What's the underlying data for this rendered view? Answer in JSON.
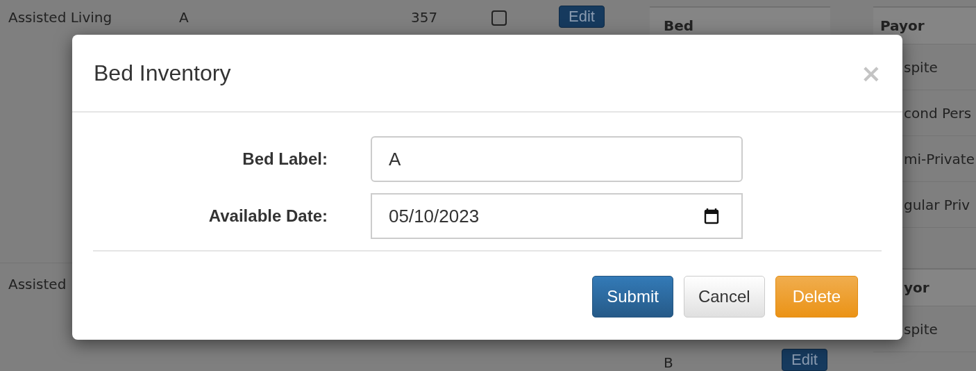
{
  "background": {
    "rows": [
      {
        "type": "Assisted Living",
        "bed": "A",
        "number": "357",
        "checked": false,
        "button": "Edit"
      },
      {
        "type": "Assisted"
      }
    ],
    "bed_panel": {
      "header": "Bed",
      "rows": [
        {
          "bed": "B",
          "button": "Edit"
        }
      ]
    },
    "payor_panels": [
      {
        "header": "Payor",
        "rows": [
          "spite",
          "cond Pers",
          "mi-Private",
          "gular Priv"
        ]
      },
      {
        "header": "yor",
        "rows": [
          "spite"
        ]
      }
    ]
  },
  "modal": {
    "title": "Bed Inventory",
    "close": "×",
    "fields": [
      {
        "kind": "text",
        "label": "Bed Label:",
        "value": "A"
      },
      {
        "kind": "date",
        "label": "Available Date:",
        "value": "05/10/2023"
      }
    ],
    "buttons": [
      {
        "label": "Submit",
        "kind": "primary"
      },
      {
        "label": "Cancel",
        "kind": "default"
      },
      {
        "label": "Delete",
        "kind": "warning"
      }
    ]
  }
}
